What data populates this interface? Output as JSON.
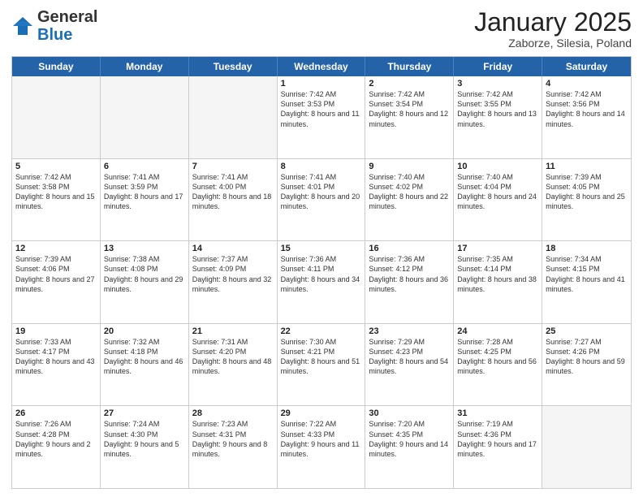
{
  "header": {
    "logo_general": "General",
    "logo_blue": "Blue",
    "month_title": "January 2025",
    "location": "Zaborze, Silesia, Poland"
  },
  "days_of_week": [
    "Sunday",
    "Monday",
    "Tuesday",
    "Wednesday",
    "Thursday",
    "Friday",
    "Saturday"
  ],
  "weeks": [
    [
      {
        "day": "",
        "info": "",
        "empty": true
      },
      {
        "day": "",
        "info": "",
        "empty": true
      },
      {
        "day": "",
        "info": "",
        "empty": true
      },
      {
        "day": "1",
        "info": "Sunrise: 7:42 AM\nSunset: 3:53 PM\nDaylight: 8 hours\nand 11 minutes.",
        "empty": false
      },
      {
        "day": "2",
        "info": "Sunrise: 7:42 AM\nSunset: 3:54 PM\nDaylight: 8 hours\nand 12 minutes.",
        "empty": false
      },
      {
        "day": "3",
        "info": "Sunrise: 7:42 AM\nSunset: 3:55 PM\nDaylight: 8 hours\nand 13 minutes.",
        "empty": false
      },
      {
        "day": "4",
        "info": "Sunrise: 7:42 AM\nSunset: 3:56 PM\nDaylight: 8 hours\nand 14 minutes.",
        "empty": false
      }
    ],
    [
      {
        "day": "5",
        "info": "Sunrise: 7:42 AM\nSunset: 3:58 PM\nDaylight: 8 hours\nand 15 minutes.",
        "empty": false
      },
      {
        "day": "6",
        "info": "Sunrise: 7:41 AM\nSunset: 3:59 PM\nDaylight: 8 hours\nand 17 minutes.",
        "empty": false
      },
      {
        "day": "7",
        "info": "Sunrise: 7:41 AM\nSunset: 4:00 PM\nDaylight: 8 hours\nand 18 minutes.",
        "empty": false
      },
      {
        "day": "8",
        "info": "Sunrise: 7:41 AM\nSunset: 4:01 PM\nDaylight: 8 hours\nand 20 minutes.",
        "empty": false
      },
      {
        "day": "9",
        "info": "Sunrise: 7:40 AM\nSunset: 4:02 PM\nDaylight: 8 hours\nand 22 minutes.",
        "empty": false
      },
      {
        "day": "10",
        "info": "Sunrise: 7:40 AM\nSunset: 4:04 PM\nDaylight: 8 hours\nand 24 minutes.",
        "empty": false
      },
      {
        "day": "11",
        "info": "Sunrise: 7:39 AM\nSunset: 4:05 PM\nDaylight: 8 hours\nand 25 minutes.",
        "empty": false
      }
    ],
    [
      {
        "day": "12",
        "info": "Sunrise: 7:39 AM\nSunset: 4:06 PM\nDaylight: 8 hours\nand 27 minutes.",
        "empty": false
      },
      {
        "day": "13",
        "info": "Sunrise: 7:38 AM\nSunset: 4:08 PM\nDaylight: 8 hours\nand 29 minutes.",
        "empty": false
      },
      {
        "day": "14",
        "info": "Sunrise: 7:37 AM\nSunset: 4:09 PM\nDaylight: 8 hours\nand 32 minutes.",
        "empty": false
      },
      {
        "day": "15",
        "info": "Sunrise: 7:36 AM\nSunset: 4:11 PM\nDaylight: 8 hours\nand 34 minutes.",
        "empty": false
      },
      {
        "day": "16",
        "info": "Sunrise: 7:36 AM\nSunset: 4:12 PM\nDaylight: 8 hours\nand 36 minutes.",
        "empty": false
      },
      {
        "day": "17",
        "info": "Sunrise: 7:35 AM\nSunset: 4:14 PM\nDaylight: 8 hours\nand 38 minutes.",
        "empty": false
      },
      {
        "day": "18",
        "info": "Sunrise: 7:34 AM\nSunset: 4:15 PM\nDaylight: 8 hours\nand 41 minutes.",
        "empty": false
      }
    ],
    [
      {
        "day": "19",
        "info": "Sunrise: 7:33 AM\nSunset: 4:17 PM\nDaylight: 8 hours\nand 43 minutes.",
        "empty": false
      },
      {
        "day": "20",
        "info": "Sunrise: 7:32 AM\nSunset: 4:18 PM\nDaylight: 8 hours\nand 46 minutes.",
        "empty": false
      },
      {
        "day": "21",
        "info": "Sunrise: 7:31 AM\nSunset: 4:20 PM\nDaylight: 8 hours\nand 48 minutes.",
        "empty": false
      },
      {
        "day": "22",
        "info": "Sunrise: 7:30 AM\nSunset: 4:21 PM\nDaylight: 8 hours\nand 51 minutes.",
        "empty": false
      },
      {
        "day": "23",
        "info": "Sunrise: 7:29 AM\nSunset: 4:23 PM\nDaylight: 8 hours\nand 54 minutes.",
        "empty": false
      },
      {
        "day": "24",
        "info": "Sunrise: 7:28 AM\nSunset: 4:25 PM\nDaylight: 8 hours\nand 56 minutes.",
        "empty": false
      },
      {
        "day": "25",
        "info": "Sunrise: 7:27 AM\nSunset: 4:26 PM\nDaylight: 8 hours\nand 59 minutes.",
        "empty": false
      }
    ],
    [
      {
        "day": "26",
        "info": "Sunrise: 7:26 AM\nSunset: 4:28 PM\nDaylight: 9 hours\nand 2 minutes.",
        "empty": false
      },
      {
        "day": "27",
        "info": "Sunrise: 7:24 AM\nSunset: 4:30 PM\nDaylight: 9 hours\nand 5 minutes.",
        "empty": false
      },
      {
        "day": "28",
        "info": "Sunrise: 7:23 AM\nSunset: 4:31 PM\nDaylight: 9 hours\nand 8 minutes.",
        "empty": false
      },
      {
        "day": "29",
        "info": "Sunrise: 7:22 AM\nSunset: 4:33 PM\nDaylight: 9 hours\nand 11 minutes.",
        "empty": false
      },
      {
        "day": "30",
        "info": "Sunrise: 7:20 AM\nSunset: 4:35 PM\nDaylight: 9 hours\nand 14 minutes.",
        "empty": false
      },
      {
        "day": "31",
        "info": "Sunrise: 7:19 AM\nSunset: 4:36 PM\nDaylight: 9 hours\nand 17 minutes.",
        "empty": false
      },
      {
        "day": "",
        "info": "",
        "empty": true
      }
    ]
  ]
}
